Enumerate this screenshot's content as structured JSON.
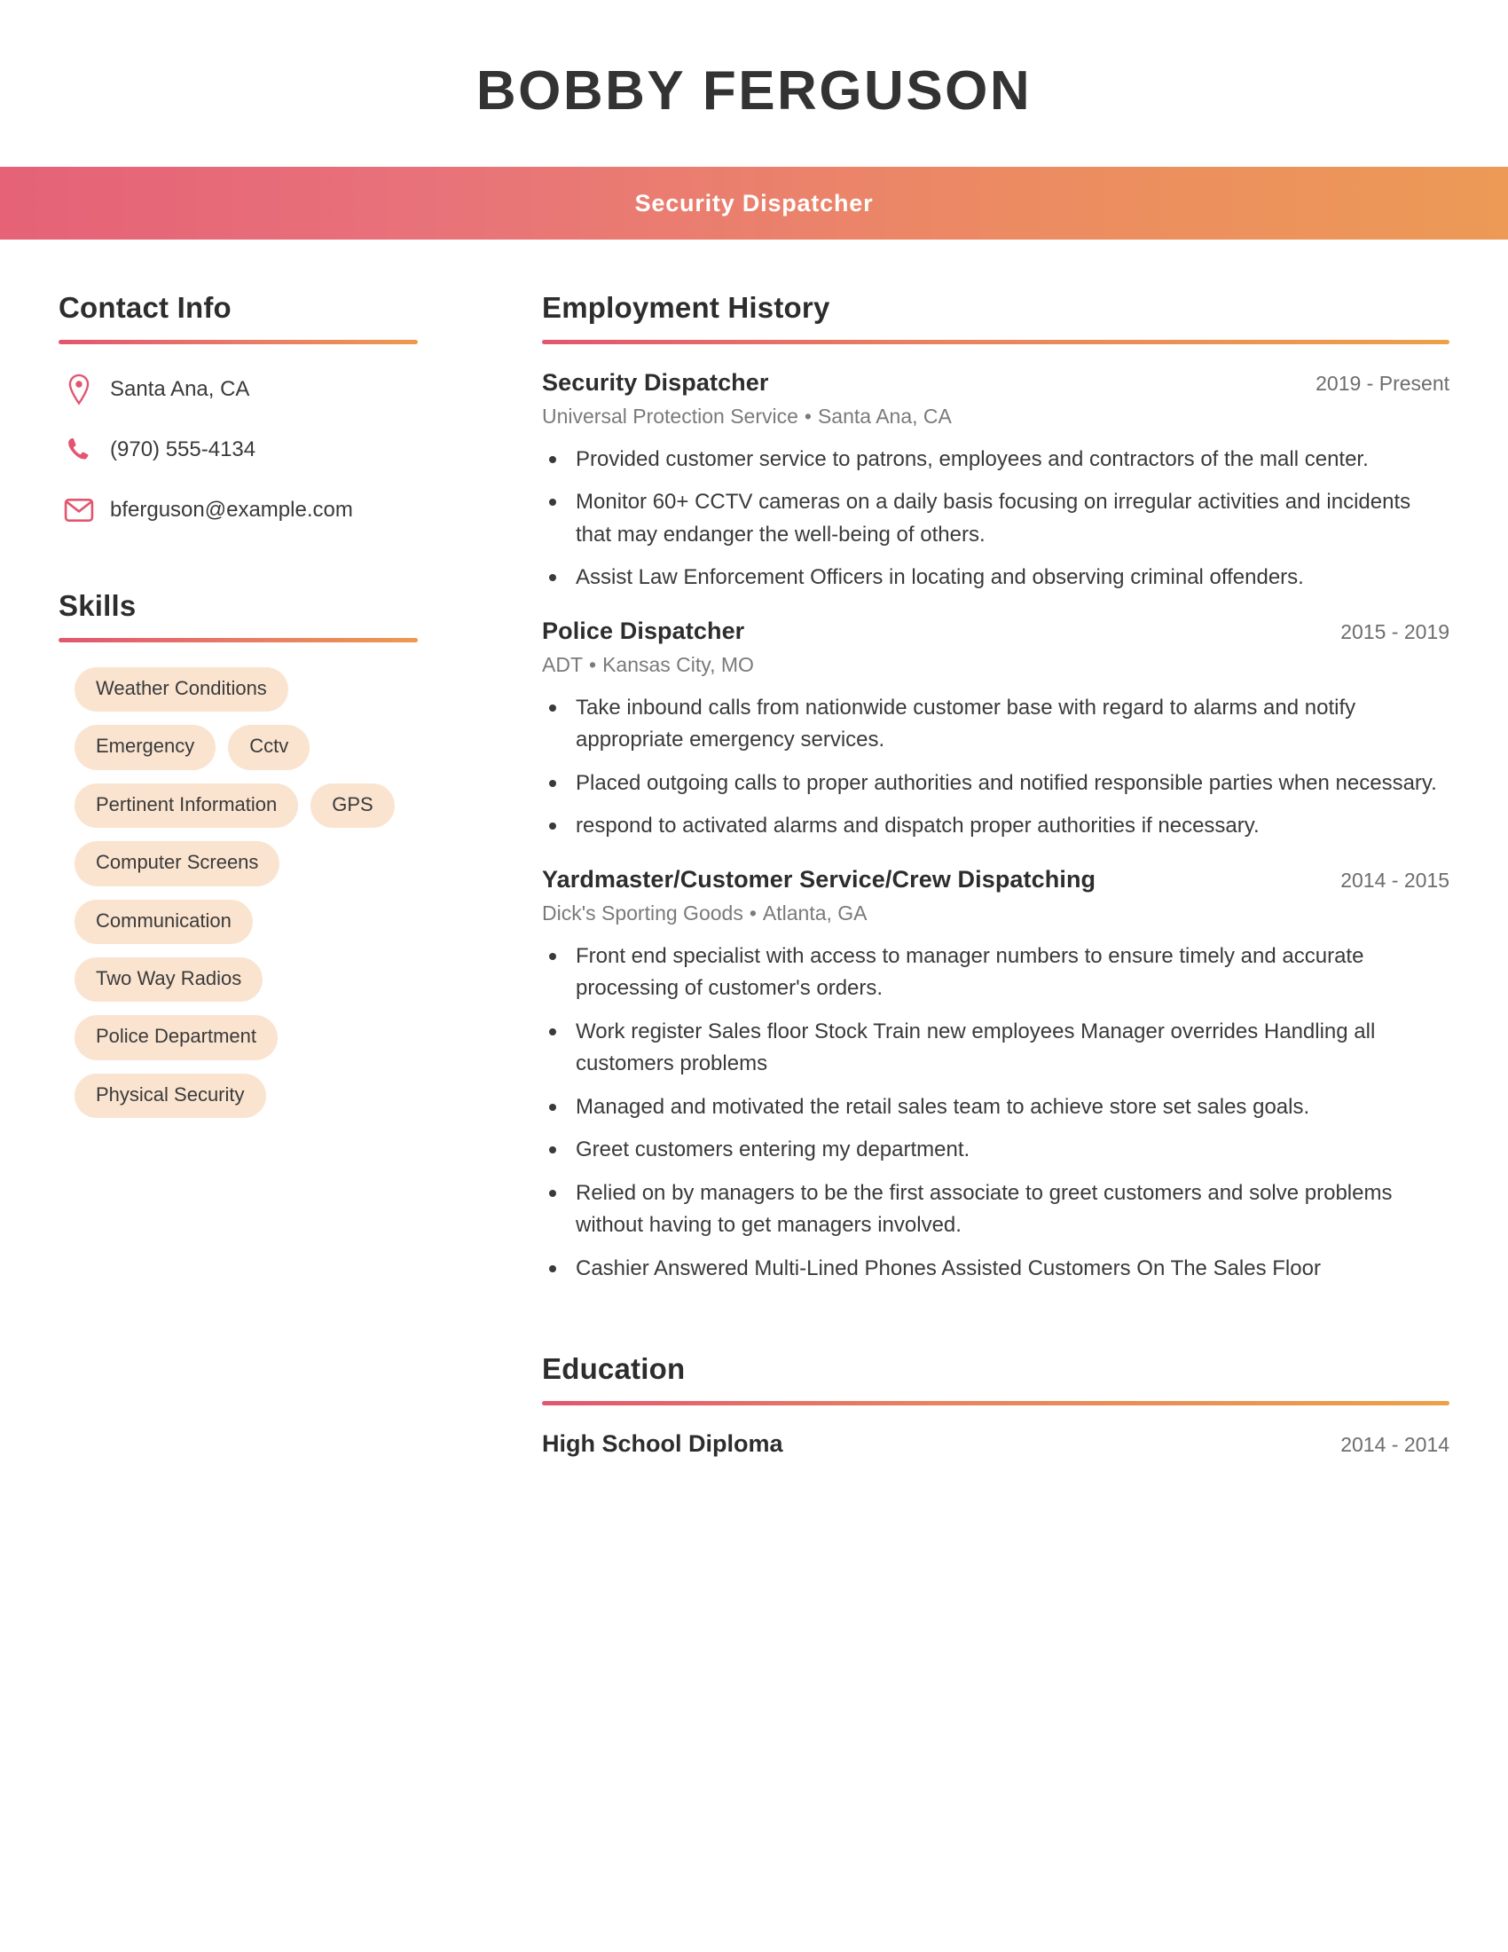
{
  "header": {
    "full_name": "BOBBY FERGUSON",
    "job_title": "Security Dispatcher"
  },
  "theme": {
    "gradient_start": "#e56277",
    "gradient_end": "#ec9a56",
    "accent_pink": "#e2566f",
    "accent_orange": "#ec9a4e",
    "chip_background": "#fae4d0",
    "text_primary": "#333333",
    "text_muted": "#7a7a7a"
  },
  "sidebar": {
    "contact": {
      "title": "Contact Info",
      "items": [
        {
          "icon": "location-pin-icon",
          "value": "Santa Ana, CA"
        },
        {
          "icon": "phone-icon",
          "value": "(970) 555-4134"
        },
        {
          "icon": "envelope-icon",
          "value": "bferguson@example.com"
        }
      ]
    },
    "skills": {
      "title": "Skills",
      "items": [
        "Weather Conditions",
        "Emergency",
        "Cctv",
        "Pertinent Information",
        "GPS",
        "Computer Screens",
        "Communication",
        "Two Way Radios",
        "Police Department",
        "Physical Security"
      ]
    }
  },
  "main": {
    "experience": {
      "title": "Employment History",
      "jobs": [
        {
          "role": "Security Dispatcher",
          "dates": "2019 - Present",
          "company": "Universal Protection Service",
          "location": "Santa Ana, CA",
          "separator": "•",
          "bullets": [
            "Provided customer service to patrons, employees and contractors of the mall center.",
            "Monitor 60+ CCTV cameras on a daily basis focusing on irregular activities and incidents that may endanger the well-being of others.",
            "Assist Law Enforcement Officers in locating and observing criminal offenders."
          ]
        },
        {
          "role": "Police Dispatcher",
          "dates": "2015 - 2019",
          "company": "ADT",
          "location": "Kansas City, MO",
          "separator": "•",
          "bullets": [
            "Take inbound calls from nationwide customer base with regard to alarms and notify appropriate emergency services.",
            "Placed outgoing calls to proper authorities and notified responsible parties when necessary.",
            "respond to activated alarms and dispatch proper authorities if necessary."
          ]
        },
        {
          "role": "Yardmaster/Customer Service/Crew Dispatching",
          "dates": "2014 - 2015",
          "company": "Dick's Sporting Goods",
          "location": "Atlanta, GA",
          "separator": "•",
          "bullets": [
            "Front end specialist with access to manager numbers to ensure timely and accurate processing of customer's orders.",
            "Work register Sales floor Stock Train new employees Manager overrides Handling all customers problems",
            "Managed and motivated the retail sales team to achieve store set sales goals.",
            "Greet customers entering my department.",
            "Relied on by managers to be the first associate to greet customers and solve problems without having to get managers involved.",
            "Cashier Answered Multi-Lined Phones Assisted Customers On The Sales Floor"
          ]
        }
      ]
    },
    "education": {
      "title": "Education",
      "entries": [
        {
          "degree": "High School Diploma",
          "dates": "2014 - 2014"
        }
      ]
    }
  }
}
